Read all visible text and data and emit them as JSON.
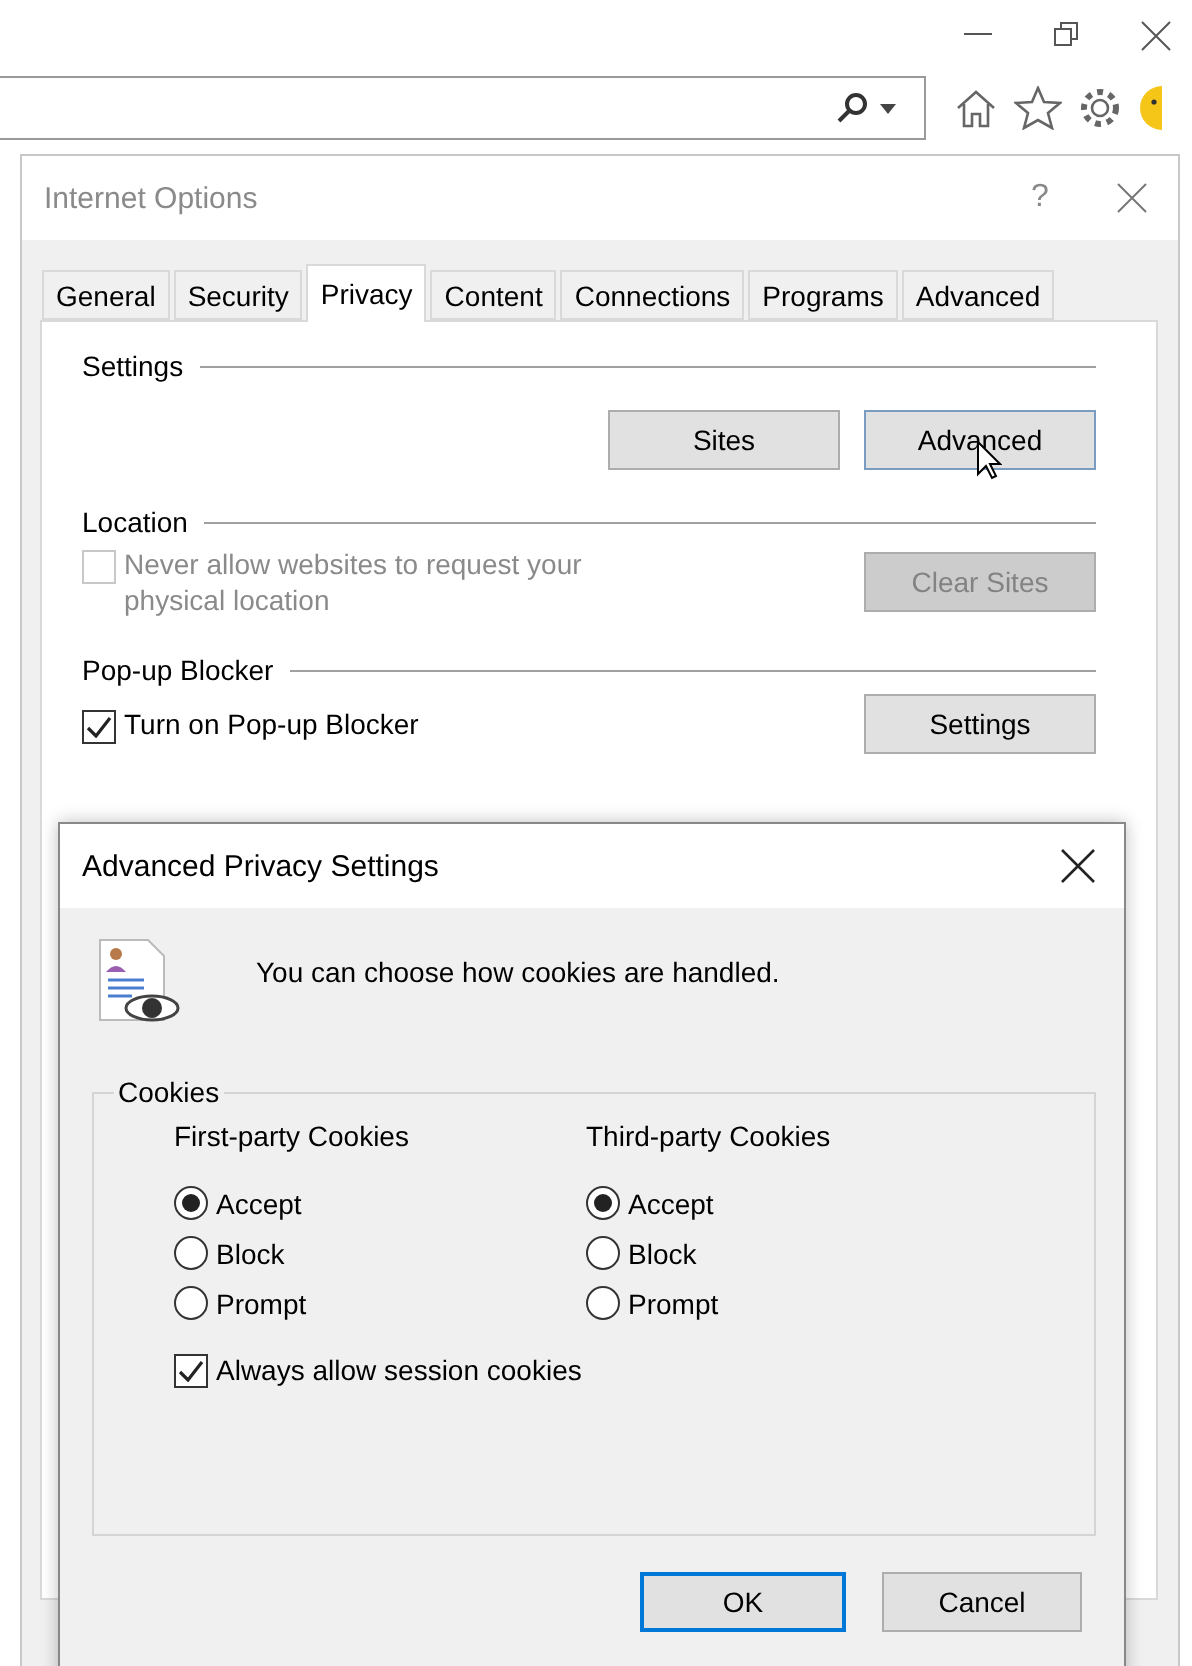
{
  "internet_options": {
    "title": "Internet Options",
    "help": "?",
    "tabs": [
      {
        "label": "General",
        "selected": false
      },
      {
        "label": "Security",
        "selected": false
      },
      {
        "label": "Privacy",
        "selected": true
      },
      {
        "label": "Content",
        "selected": false
      },
      {
        "label": "Connections",
        "selected": false
      },
      {
        "label": "Programs",
        "selected": false
      },
      {
        "label": "Advanced",
        "selected": false
      }
    ],
    "sections": [
      {
        "title": "Settings",
        "kind": "buttons",
        "buttons": [
          {
            "label": "Sites",
            "disabled": false,
            "hovered": false
          },
          {
            "label": "Advanced",
            "disabled": false,
            "hovered": true
          }
        ]
      },
      {
        "title": "Location",
        "kind": "checkbox",
        "checkbox": {
          "label": "Never allow websites to request your physical location",
          "checked": false,
          "disabled": true
        },
        "button": {
          "label": "Clear Sites",
          "disabled": true
        }
      },
      {
        "title": "Pop-up Blocker",
        "kind": "checkbox",
        "checkbox": {
          "label": "Turn on Pop-up Blocker",
          "checked": true,
          "disabled": false
        },
        "button": {
          "label": "Settings",
          "disabled": false
        }
      }
    ]
  },
  "privacy_dialog": {
    "title": "Advanced Privacy Settings",
    "message": "You can choose how cookies are handled.",
    "group_title": "Cookies",
    "columns": [
      {
        "heading": "First-party Cookies",
        "options": [
          {
            "label": "Accept",
            "selected": true
          },
          {
            "label": "Block",
            "selected": false
          },
          {
            "label": "Prompt",
            "selected": false
          }
        ]
      },
      {
        "heading": "Third-party Cookies",
        "options": [
          {
            "label": "Accept",
            "selected": true
          },
          {
            "label": "Block",
            "selected": false
          },
          {
            "label": "Prompt",
            "selected": false
          }
        ]
      }
    ],
    "session_checkbox": {
      "label": "Always allow session cookies",
      "checked": true
    },
    "buttons": [
      {
        "label": "OK",
        "default": true
      },
      {
        "label": "Cancel",
        "default": false
      }
    ]
  }
}
